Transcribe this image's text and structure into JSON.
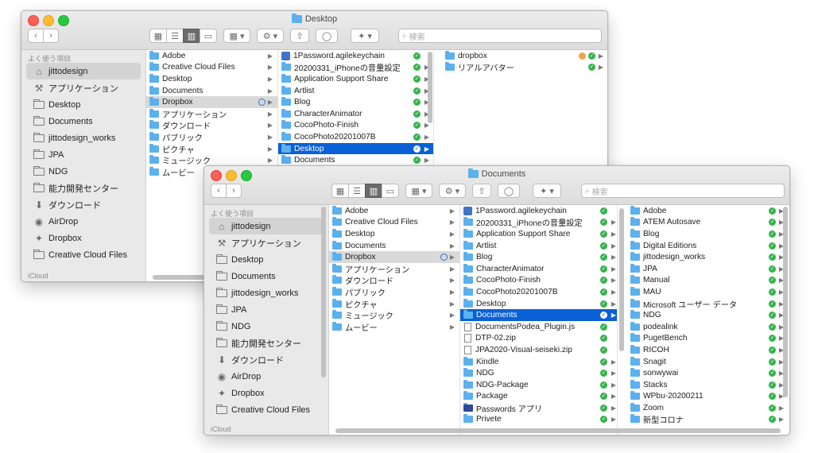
{
  "front": {
    "title": "Documents",
    "search_placeholder": "検索",
    "sidebar_header": "よく使う項目",
    "sidebar_footer": "iCloud",
    "sidebar": [
      "jittodesign",
      "アプリケーション",
      "Desktop",
      "Documents",
      "jittodesign_works",
      "JPA",
      "NDG",
      "能力開発センター",
      "ダウンロード",
      "AirDrop",
      "Dropbox",
      "Creative Cloud Files"
    ],
    "col1": [
      "Adobe",
      "Creative Cloud Files",
      "Desktop",
      "Documents",
      "Dropbox",
      "アプリケーション",
      "ダウンロード",
      "パブリック",
      "ピクチャ",
      "ミュージック",
      "ムービー"
    ],
    "col2": [
      "1Password.agilekeychain",
      "20200331_iPhoneの音量設定",
      "Application Support Share",
      "Artlist",
      "Blog",
      "CharacterAnimator",
      "CocoPhoto-Finish",
      "CocoPhoto20201007B",
      "Desktop",
      "Documents",
      "DocumentsPodea_Plugin.js",
      "DTP-02.zip",
      "JPA2020-Visual-seiseki.zip",
      "Kindle",
      "NDG",
      "NDG-Package",
      "Package",
      "Passwords アプリ",
      "Privete"
    ],
    "col3": [
      "Adobe",
      "ATEM Autosave",
      "Blog",
      "Digital Editions",
      "jittodesign_works",
      "JPA",
      "Manual",
      "MAU",
      "Microsoft ユーザー データ",
      "NDG",
      "podealink",
      "PugetBench",
      "RICOH",
      "Snagit",
      "sonwywai",
      "Stacks",
      "WPbu-20200211",
      "Zoom",
      "新型コロナ"
    ]
  },
  "back": {
    "title": "Desktop",
    "search_placeholder": "検索",
    "sidebar_header": "よく使う項目",
    "sidebar_footer": "iCloud",
    "sidebar": [
      "jittodesign",
      "アプリケーション",
      "Desktop",
      "Documents",
      "jittodesign_works",
      "JPA",
      "NDG",
      "能力開発センター",
      "ダウンロード",
      "AirDrop",
      "Dropbox",
      "Creative Cloud Files"
    ],
    "col1": [
      "Adobe",
      "Creative Cloud Files",
      "Desktop",
      "Documents",
      "Dropbox",
      "アプリケーション",
      "ダウンロード",
      "パブリック",
      "ピクチャ",
      "ミュージック",
      "ムービー"
    ],
    "col2": [
      "1Password.agilekeychain",
      "20200331_iPhoneの音量設定",
      "Application Support Share",
      "Artlist",
      "Blog",
      "CharacterAnimator",
      "CocoPhoto-Finish",
      "CocoPhoto20201007B",
      "Desktop",
      "Documents"
    ],
    "col3": [
      "dropbox",
      "リアルアバター"
    ]
  }
}
